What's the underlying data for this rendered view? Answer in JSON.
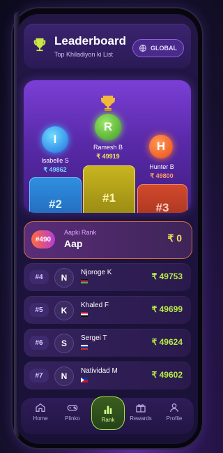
{
  "header": {
    "title": "Leaderboard",
    "subtitle": "Top Khiladiyon ki List",
    "global_label": "GLOBAL"
  },
  "podium": {
    "first": {
      "initial": "R",
      "name": "Ramesh B",
      "amount": "₹ 49919",
      "place": "#1"
    },
    "second": {
      "initial": "I",
      "name": "Isabelle S",
      "amount": "₹ 49862",
      "place": "#2"
    },
    "third": {
      "initial": "H",
      "name": "Hunter B",
      "amount": "₹ 49800",
      "place": "#3"
    }
  },
  "my_rank": {
    "rank": "#490",
    "label": "Aapki Rank",
    "name": "Aap",
    "amount": "₹ 0"
  },
  "list": [
    {
      "rank": "#4",
      "initial": "N",
      "name": "Njoroge K",
      "amount": "₹ 49753",
      "flag": "kenya"
    },
    {
      "rank": "#5",
      "initial": "K",
      "name": "Khaled F",
      "amount": "₹ 49699",
      "flag": "egypt"
    },
    {
      "rank": "#6",
      "initial": "S",
      "name": "Sergei T",
      "amount": "₹ 49624",
      "flag": "russia"
    },
    {
      "rank": "#7",
      "initial": "N",
      "name": "Natividad M",
      "amount": "₹ 49602",
      "flag": "philippines"
    }
  ],
  "nav": [
    {
      "label": "Home",
      "icon": "home-icon"
    },
    {
      "label": "Plinko",
      "icon": "gamepad-icon"
    },
    {
      "label": "Rank",
      "icon": "bar-chart-icon",
      "active": true
    },
    {
      "label": "Rewards",
      "icon": "gift-icon"
    },
    {
      "label": "Profile",
      "icon": "user-icon"
    }
  ],
  "colors": {
    "accent": "#a6e84a",
    "gold": "#f2e05a",
    "background": "#1d1340"
  }
}
